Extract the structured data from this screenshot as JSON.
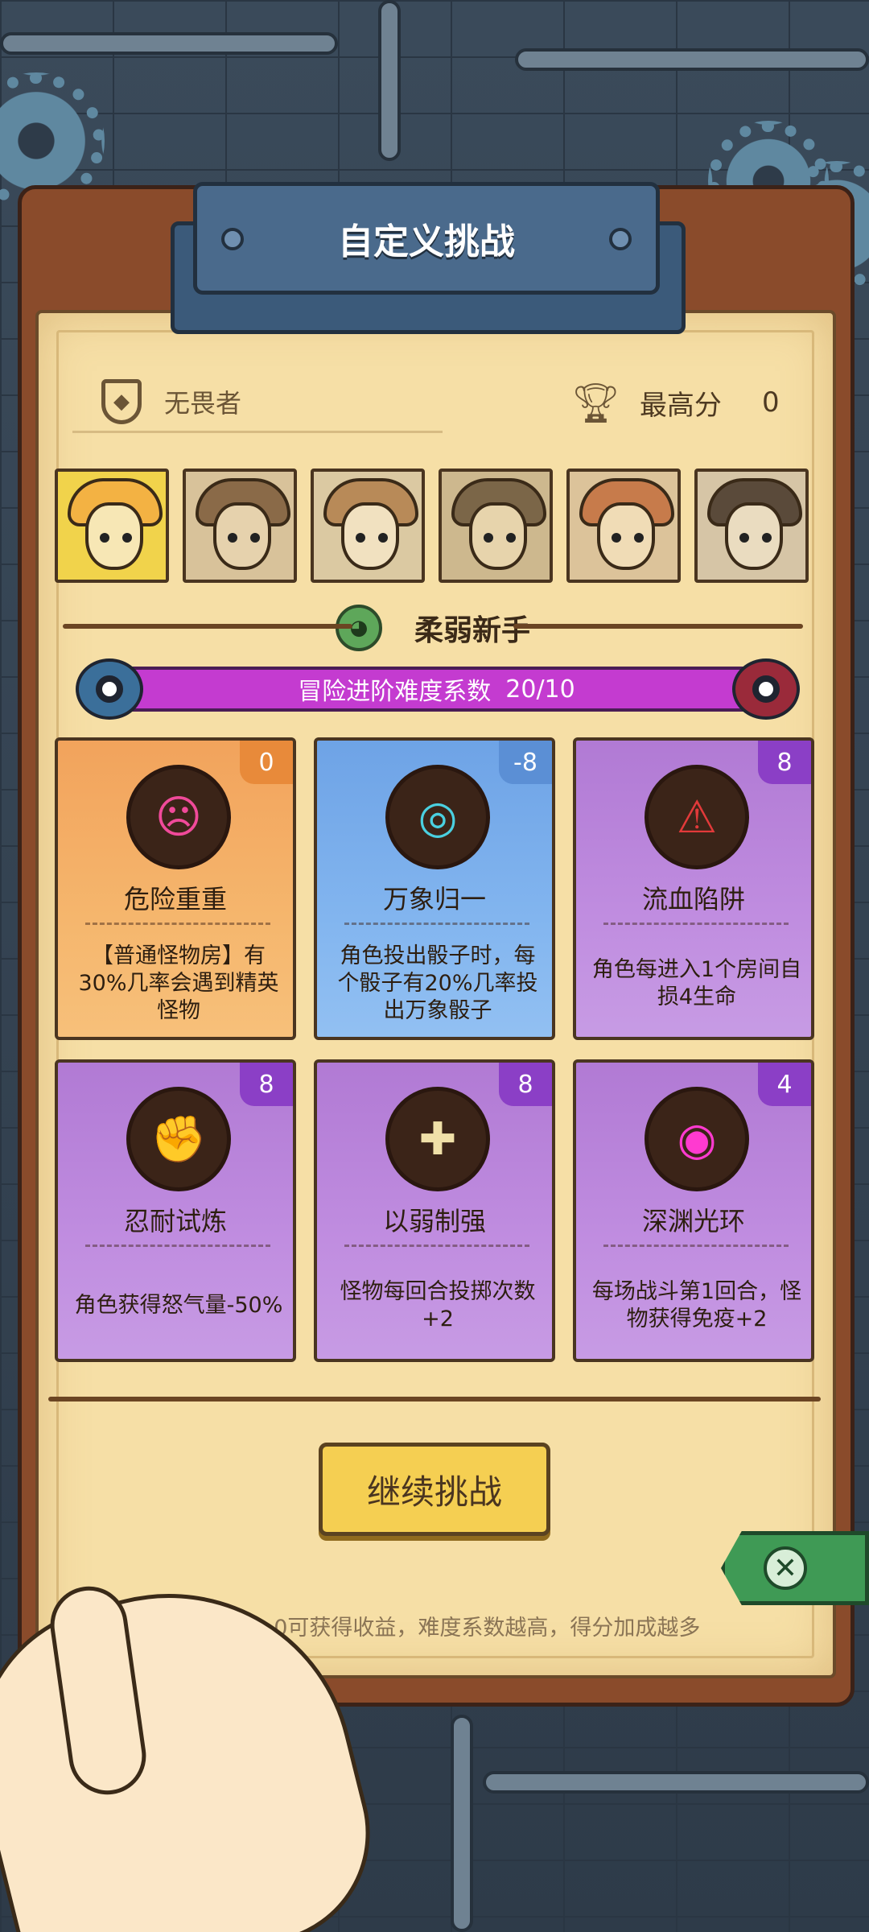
{
  "header": {
    "title": "自定义挑战"
  },
  "player": {
    "name": "无畏者"
  },
  "highscore": {
    "label": "最高分",
    "value": "0"
  },
  "characters": [
    {
      "id": "char-1",
      "bg": "#f1d34b",
      "skin": "#f7e7b5",
      "hair": "#f3b243"
    },
    {
      "id": "char-2",
      "bg": "#d8c29a",
      "skin": "#e6d2ad",
      "hair": "#8a6a48"
    },
    {
      "id": "char-3",
      "bg": "#dbc9a2",
      "skin": "#f1e1c0",
      "hair": "#b88a58"
    },
    {
      "id": "char-4",
      "bg": "#cdb88e",
      "skin": "#e7d4ac",
      "hair": "#7b6648"
    },
    {
      "id": "char-5",
      "bg": "#dcc39a",
      "skin": "#f0dcb6",
      "hair": "#c77b4b"
    },
    {
      "id": "char-6",
      "bg": "#d6c5a6",
      "skin": "#eadcc0",
      "hair": "#5a4a3a"
    }
  ],
  "difficulty": {
    "name": "柔弱新手"
  },
  "advance": {
    "label": "冒险进阶难度系数",
    "value": "20/10"
  },
  "modifiers": [
    {
      "title": "危险重重",
      "value": "0",
      "desc": "【普通怪物房】有30%几率会遇到精英怪物",
      "color": "orange",
      "icon": "angry-face-icon",
      "glyph": "☹"
    },
    {
      "title": "万象归一",
      "value": "-8",
      "desc": "角色投出骰子时，每个骰子有20%几率投出万象骰子",
      "color": "blue",
      "icon": "rainbow-swirl-icon",
      "glyph": "◎"
    },
    {
      "title": "流血陷阱",
      "value": "8",
      "desc": "角色每进入1个房间自损4生命",
      "color": "purple",
      "icon": "bear-trap-icon",
      "glyph": "⚠"
    },
    {
      "title": "忍耐试炼",
      "value": "8",
      "desc": "角色获得怒气量-50%",
      "color": "purple",
      "icon": "fist-shield-icon",
      "glyph": "✊"
    },
    {
      "title": "以弱制强",
      "value": "8",
      "desc": "怪物每回合投掷次数+2",
      "color": "purple",
      "icon": "bone-icon",
      "glyph": "✚"
    },
    {
      "title": "深渊光环",
      "value": "4",
      "desc": "每场战斗第1回合，怪物获得免疫+2",
      "color": "purple",
      "icon": "abyss-halo-icon",
      "glyph": "◉"
    }
  ],
  "continue_button": {
    "label": "继续挑战"
  },
  "hint": "难度系数>0可获得收益，难度系数越高，得分加成越多",
  "close": {
    "glyph": "✕"
  }
}
